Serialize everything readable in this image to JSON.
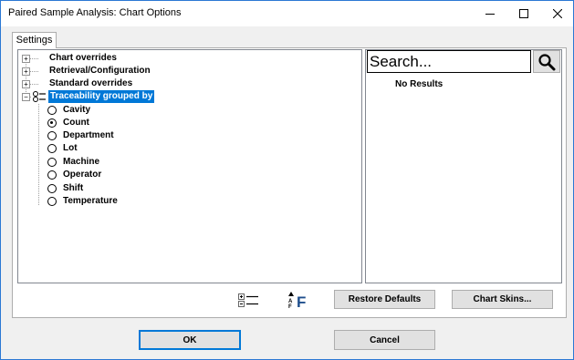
{
  "window": {
    "title": "Paired Sample Analysis:  Chart Options"
  },
  "tabs": [
    {
      "label": "Settings",
      "active": true
    }
  ],
  "tree": {
    "nodes": [
      {
        "label": "Chart overrides",
        "expanded": false
      },
      {
        "label": "Retrieval/Configuration",
        "expanded": false
      },
      {
        "label": "Standard overrides",
        "expanded": false
      },
      {
        "label": "Traceability grouped by",
        "expanded": true,
        "selected": true
      }
    ],
    "options": [
      {
        "label": "Cavity",
        "checked": false
      },
      {
        "label": "Count",
        "checked": true
      },
      {
        "label": "Department",
        "checked": false
      },
      {
        "label": "Lot",
        "checked": false
      },
      {
        "label": "Machine",
        "checked": false
      },
      {
        "label": "Operator",
        "checked": false
      },
      {
        "label": "Shift",
        "checked": false
      },
      {
        "label": "Temperature",
        "checked": false
      }
    ]
  },
  "search": {
    "placeholder": "Search...",
    "no_results": "No Results"
  },
  "toolbar": {
    "restore_label": "Restore Defaults",
    "skins_label": "Chart Skins..."
  },
  "dialog": {
    "ok_label": "OK",
    "cancel_label": "Cancel"
  },
  "colors": {
    "selection": "#0078d7",
    "window_border": "#2b78d4"
  }
}
